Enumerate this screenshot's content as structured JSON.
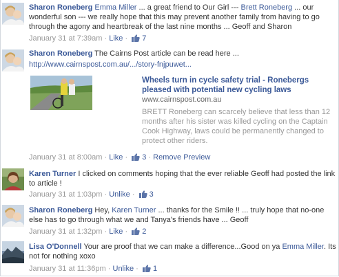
{
  "comments": [
    {
      "author": "Sharon Roneberg",
      "segments": [
        {
          "text": "Emma Miller",
          "link": true
        },
        {
          "text": " ... a great friend to Our Girl --- ",
          "link": false
        },
        {
          "text": "Brett Roneberg",
          "link": true
        },
        {
          "text": " ... our wonderful son --- we really hope that this may prevent another family from having to go through the agony and heartbreak of the last nine months ... Geoff and Sharon",
          "link": false
        }
      ],
      "timestamp": "January 31 at 7:39am",
      "action": "Like",
      "likes": "7"
    },
    {
      "author": "Sharon Roneberg",
      "text": "The Cairns Post article can be read here ...",
      "url": "http://www.cairnspost.com.au/.../story-fnjpuwet...",
      "preview": {
        "title": "Wheels turn in cycle safety trial - Ronebergs pleased with potential new cycling laws",
        "domain": "www.cairnspost.com.au",
        "description": "BRETT Roneberg can scarcely believe that less than 12 months after his sister was killed cycling on the Captain Cook Highway, laws could be permanently changed to protect other riders."
      },
      "timestamp": "January 31 at 8:00am",
      "action": "Like",
      "likes": "3",
      "extra_action": "Remove Preview"
    },
    {
      "author": "Karen Turner",
      "text": "I clicked on comments hoping that the ever reliable Geoff had posted the link to article !",
      "timestamp": "January 31 at 1:03pm",
      "action": "Unlike",
      "likes": "3"
    },
    {
      "author": "Sharon Roneberg",
      "segments": [
        {
          "text": "Hey, ",
          "link": false
        },
        {
          "text": "Karen Turner",
          "link": true
        },
        {
          "text": " ... thanks for the Smile !! ... truly hope that no-one else has to go through what we and Tanya's friends have ... Geoff",
          "link": false
        }
      ],
      "timestamp": "January 31 at 1:32pm",
      "action": "Like",
      "likes": "2"
    },
    {
      "author": "Lisa O'Donnell",
      "segments": [
        {
          "text": "Your are proof that we can make a difference...Good on ya ",
          "link": false
        },
        {
          "text": "Emma Miller",
          "link": true
        },
        {
          "text": ". Its not for nothing xoxo",
          "link": false
        }
      ],
      "timestamp": "January 31 at 11:36pm",
      "action": "Unlike",
      "likes": "1"
    }
  ],
  "separator": "·",
  "icons": [
    "avatar-sharon-photo",
    "avatar-karen-photo",
    "avatar-lisa-photo",
    "thumbs-up-icon",
    "article-thumbnail-photo"
  ]
}
